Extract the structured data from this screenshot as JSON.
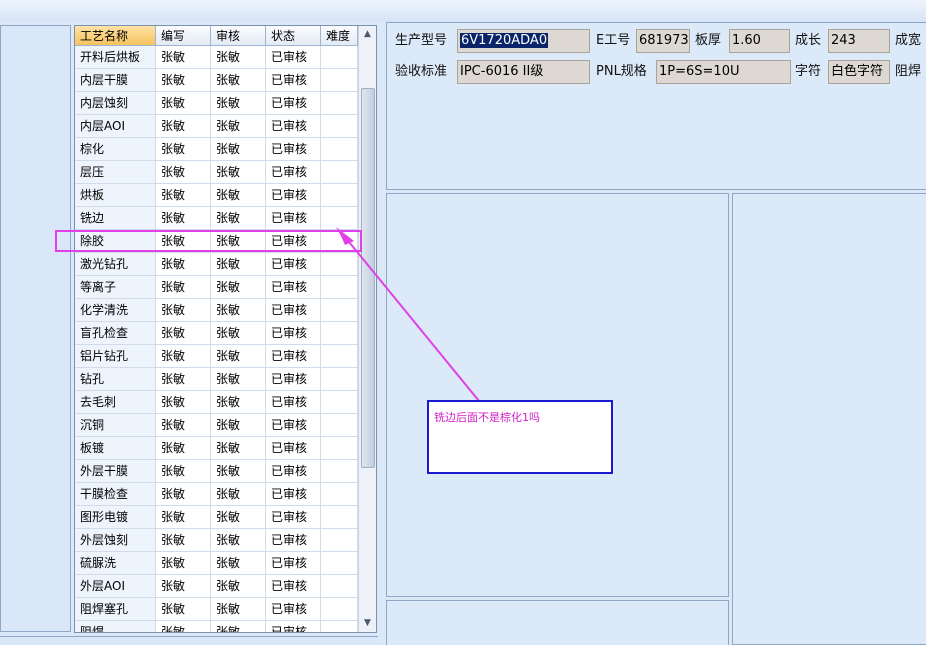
{
  "grid": {
    "columns": [
      "工艺名称",
      "编写",
      "审核",
      "状态",
      "难度"
    ],
    "rows": [
      [
        "开料后烘板",
        "张敏",
        "张敏",
        "已审核",
        ""
      ],
      [
        "内层干膜",
        "张敏",
        "张敏",
        "已审核",
        ""
      ],
      [
        "内层蚀刻",
        "张敏",
        "张敏",
        "已审核",
        ""
      ],
      [
        "内层AOI",
        "张敏",
        "张敏",
        "已审核",
        ""
      ],
      [
        "棕化",
        "张敏",
        "张敏",
        "已审核",
        ""
      ],
      [
        "层压",
        "张敏",
        "张敏",
        "已审核",
        ""
      ],
      [
        "烘板",
        "张敏",
        "张敏",
        "已审核",
        ""
      ],
      [
        "铣边",
        "张敏",
        "张敏",
        "已审核",
        ""
      ],
      [
        "除胶",
        "张敏",
        "张敏",
        "已审核",
        ""
      ],
      [
        "激光钻孔",
        "张敏",
        "张敏",
        "已审核",
        ""
      ],
      [
        "等离子",
        "张敏",
        "张敏",
        "已审核",
        ""
      ],
      [
        "化学清洗",
        "张敏",
        "张敏",
        "已审核",
        ""
      ],
      [
        "盲孔检查",
        "张敏",
        "张敏",
        "已审核",
        ""
      ],
      [
        "铝片钻孔",
        "张敏",
        "张敏",
        "已审核",
        ""
      ],
      [
        "钻孔",
        "张敏",
        "张敏",
        "已审核",
        ""
      ],
      [
        "去毛刺",
        "张敏",
        "张敏",
        "已审核",
        ""
      ],
      [
        "沉铜",
        "张敏",
        "张敏",
        "已审核",
        ""
      ],
      [
        "板镀",
        "张敏",
        "张敏",
        "已审核",
        ""
      ],
      [
        "外层干膜",
        "张敏",
        "张敏",
        "已审核",
        ""
      ],
      [
        "干膜检查",
        "张敏",
        "张敏",
        "已审核",
        ""
      ],
      [
        "图形电镀",
        "张敏",
        "张敏",
        "已审核",
        ""
      ],
      [
        "外层蚀刻",
        "张敏",
        "张敏",
        "已审核",
        ""
      ],
      [
        "硫脲洗",
        "张敏",
        "张敏",
        "已审核",
        ""
      ],
      [
        "外层AOI",
        "张敏",
        "张敏",
        "已审核",
        ""
      ],
      [
        "阻焊塞孔",
        "张敏",
        "张敏",
        "已审核",
        ""
      ],
      [
        "阻焊",
        "张敏",
        "张敏",
        "已审核",
        ""
      ]
    ]
  },
  "info": {
    "model_label": "生产型号",
    "model_value": "6V1720ADA0",
    "eno_label": "E工号",
    "eno_value": "681973",
    "thickness_label": "板厚",
    "thickness_value": "1.60",
    "length_label": "成长",
    "length_value": "243",
    "width_label": "成宽",
    "standard_label": "验收标准",
    "standard_value": "IPC-6016 II级",
    "pnl_label": "PNL规格",
    "pnl_value": "1P=6S=10U",
    "char_label": "字符",
    "char_value": "白色字符",
    "solder_label": "阻焊"
  },
  "annotation": {
    "note": "铣边后面不是棕化1吗",
    "color": "#e040e8",
    "box_border": "#1a1ad0"
  }
}
